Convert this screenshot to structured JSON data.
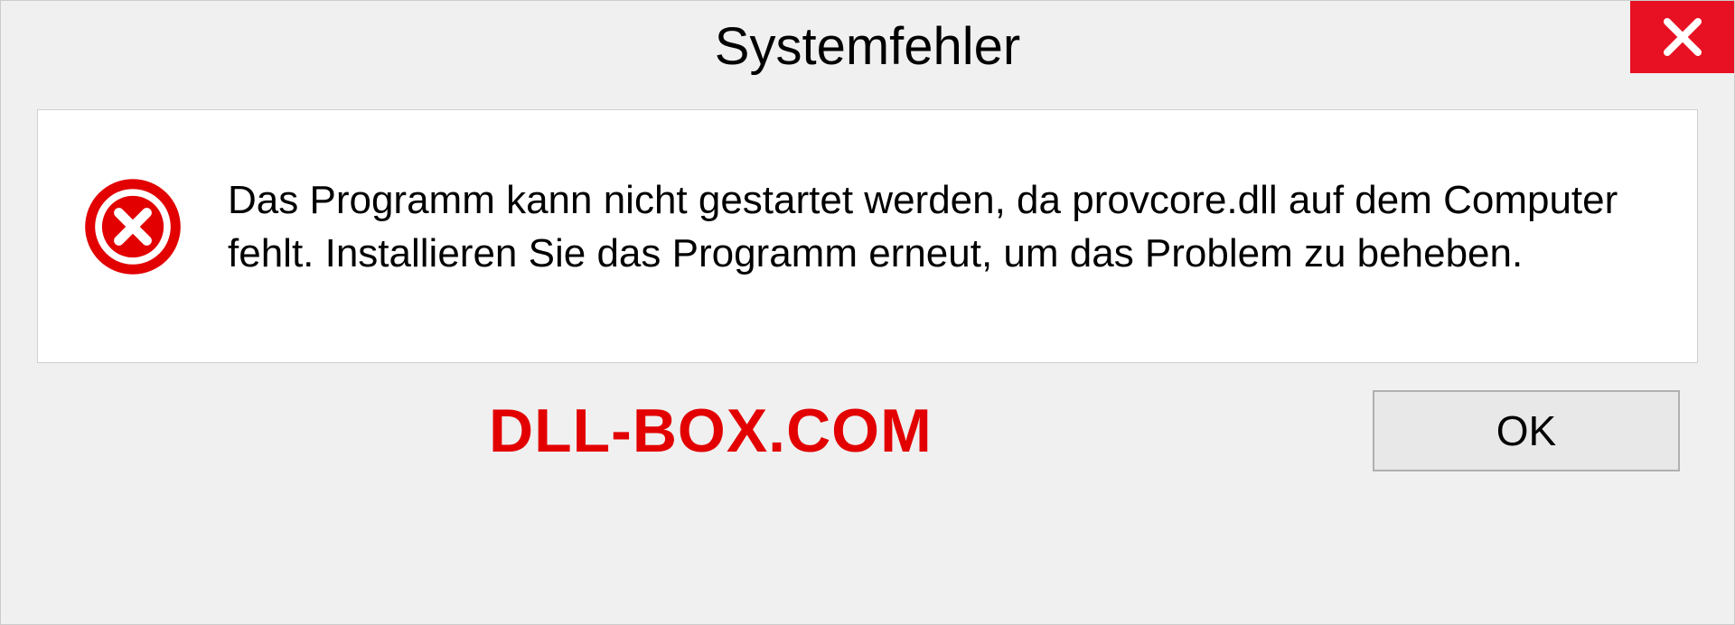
{
  "dialog": {
    "title": "Systemfehler",
    "message": "Das Programm kann nicht gestartet werden, da provcore.dll auf dem Computer fehlt. Installieren Sie das Programm erneut, um das Problem zu beheben.",
    "ok_label": "OK"
  },
  "watermark": "DLL-BOX.COM"
}
